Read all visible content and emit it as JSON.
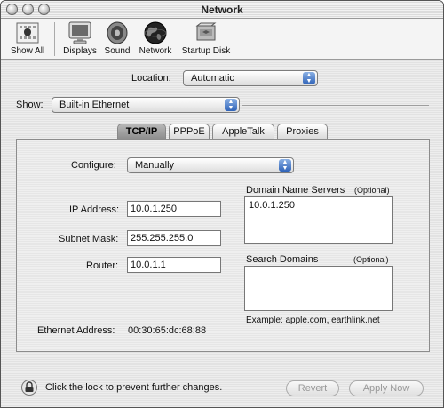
{
  "window": {
    "title": "Network"
  },
  "toolbar": {
    "items": [
      {
        "label": "Show All",
        "icon": "apple-grid-icon"
      },
      {
        "label": "Displays",
        "icon": "display-icon"
      },
      {
        "label": "Sound",
        "icon": "speaker-icon"
      },
      {
        "label": "Network",
        "icon": "globe-icon"
      },
      {
        "label": "Startup Disk",
        "icon": "hard-disk-icon"
      }
    ]
  },
  "location": {
    "label": "Location:",
    "value": "Automatic"
  },
  "show": {
    "label": "Show:",
    "value": "Built-in Ethernet"
  },
  "tabs": [
    {
      "label": "TCP/IP",
      "selected": true
    },
    {
      "label": "PPPoE",
      "selected": false
    },
    {
      "label": "AppleTalk",
      "selected": false
    },
    {
      "label": "Proxies",
      "selected": false
    }
  ],
  "tcpip": {
    "configure_label": "Configure:",
    "configure_value": "Manually",
    "ip_label": "IP Address:",
    "ip_value": "10.0.1.250",
    "subnet_label": "Subnet Mask:",
    "subnet_value": "255.255.255.0",
    "router_label": "Router:",
    "router_value": "10.0.1.1",
    "dns_label": "Domain Name Servers",
    "dns_optional": "(Optional)",
    "dns_value": "10.0.1.250",
    "search_label": "Search Domains",
    "search_optional": "(Optional)",
    "search_value": "",
    "example": "Example: apple.com, earthlink.net",
    "ethernet_label": "Ethernet Address:",
    "ethernet_value": "00:30:65:dc:68:88"
  },
  "footer": {
    "lock_text": "Click the lock to prevent further changes.",
    "revert_label": "Revert",
    "apply_label": "Apply Now"
  }
}
